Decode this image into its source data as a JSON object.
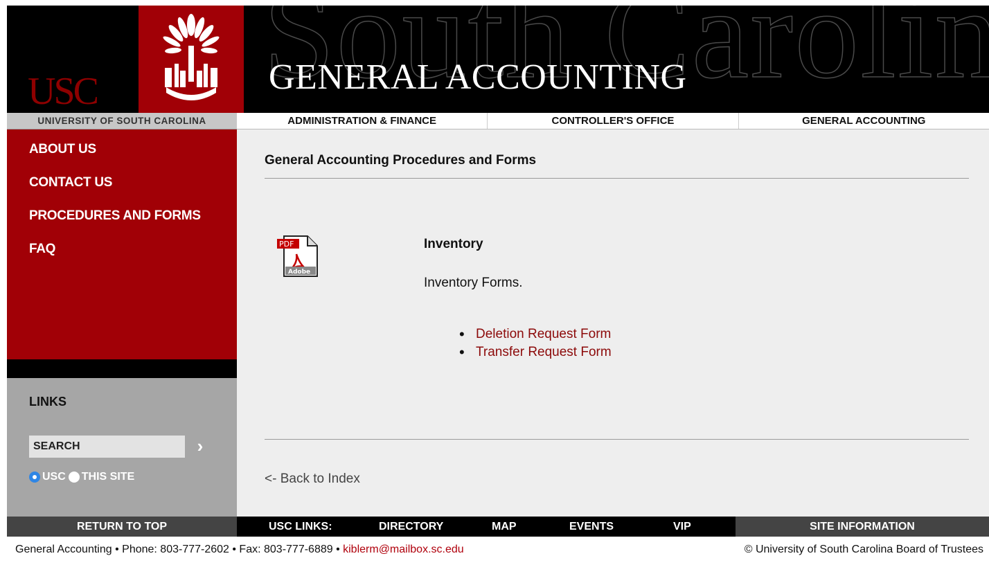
{
  "header": {
    "usc_logo": "USC",
    "watermark": "South Carolina",
    "site_title": "GENERAL ACCOUNTING"
  },
  "nav": {
    "university": "UNIVERSITY OF SOUTH CAROLINA",
    "items": [
      "ADMINISTRATION & FINANCE",
      "CONTROLLER'S OFFICE",
      "GENERAL ACCOUNTING"
    ]
  },
  "sidebar": {
    "items": [
      "ABOUT US",
      "CONTACT US",
      "PROCEDURES AND FORMS",
      "FAQ"
    ],
    "links_heading": "LINKS",
    "search_placeholder": "SEARCH",
    "radio_usc": "USC",
    "radio_site": "THIS SITE"
  },
  "main": {
    "title": "General Accounting Procedures and Forms",
    "section_title": "Inventory",
    "section_desc": "Inventory Forms.",
    "forms": [
      "Deletion Request Form",
      "Transfer Request Form"
    ],
    "back_link": "<- Back to Index"
  },
  "footer": {
    "return_top": "RETURN TO TOP",
    "usc_links": "USC LINKS:",
    "directory": "DIRECTORY",
    "map": "MAP",
    "events": "EVENTS",
    "vip": "VIP",
    "site_info": "SITE INFORMATION",
    "contact_prefix": "General Accounting • Phone: 803-777-2602 • Fax: 803-777-6889 • ",
    "email": "kiblerm@mailbox.sc.edu",
    "copyright": "© University of South Carolina Board of Trustees"
  },
  "colors": {
    "garnet": "#a10006",
    "link": "#8c0a0a",
    "black": "#000000",
    "gray_panel": "#a6a6a6"
  },
  "icons": [
    "palm-tree-icon",
    "pdf-icon",
    "chevron-right-icon"
  ]
}
